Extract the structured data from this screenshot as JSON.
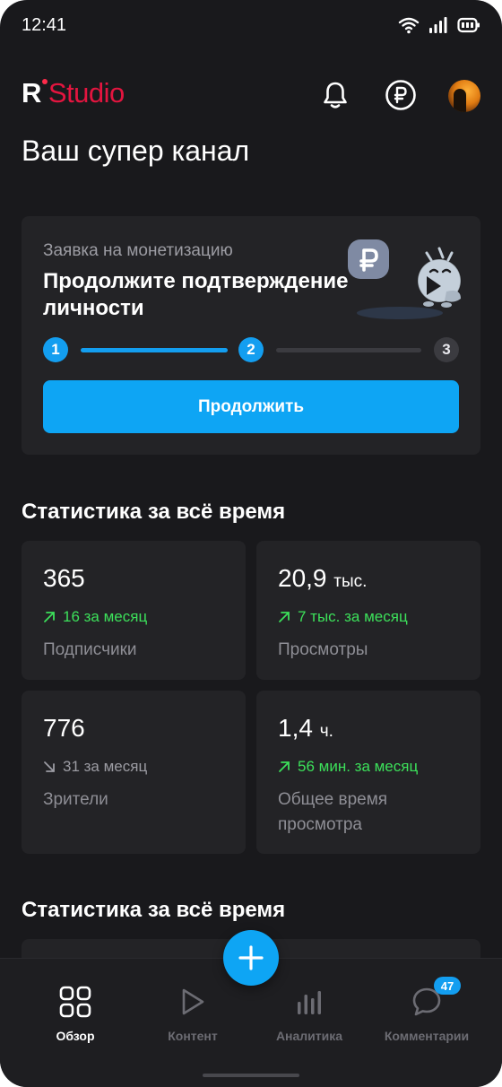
{
  "status_bar": {
    "time": "12:41",
    "icons": [
      "wifi-icon",
      "signal-icon",
      "battery-icon"
    ]
  },
  "header": {
    "logo_r": "R",
    "logo_studio": "Studio",
    "icons": [
      "bell-icon",
      "ruble-icon",
      "avatar"
    ]
  },
  "page": {
    "title": "Ваш супер канал"
  },
  "monetization": {
    "kicker": "Заявка на монетизацию",
    "heading": "Продолжите подтверждение личности",
    "steps": [
      "1",
      "2",
      "3"
    ],
    "current_step": 2,
    "button_label": "Продолжить"
  },
  "stats_section": {
    "title": "Статистика за всё время",
    "cards": [
      {
        "value": "365",
        "unit": "",
        "delta": "16 за месяц",
        "trend": "up",
        "label": "Подписчики"
      },
      {
        "value": "20,9",
        "unit": "тыс.",
        "delta": "7 тыс. за месяц",
        "trend": "up",
        "label": "Просмотры"
      },
      {
        "value": "776",
        "unit": "",
        "delta": "31 за месяц",
        "trend": "down",
        "label": "Зрители"
      },
      {
        "value": "1,4",
        "unit": "ч.",
        "delta": "56 мин. за месяц",
        "trend": "up",
        "label": "Общее время просмотра"
      }
    ]
  },
  "stats_section_2": {
    "title": "Статистика за всё время"
  },
  "nav": {
    "items": [
      {
        "label": "Обзор",
        "icon": "grid-icon",
        "active": true
      },
      {
        "label": "Контент",
        "icon": "play-icon",
        "active": false
      },
      {
        "label": "Аналитика",
        "icon": "bar-chart-icon",
        "active": false
      },
      {
        "label": "Комментарии",
        "icon": "comment-icon",
        "active": false,
        "badge": "47"
      }
    ]
  },
  "colors": {
    "accent": "#0ea5f4",
    "brand": "#e3153f",
    "positive": "#3ce05a",
    "background": "#19191c",
    "card": "#232326"
  }
}
